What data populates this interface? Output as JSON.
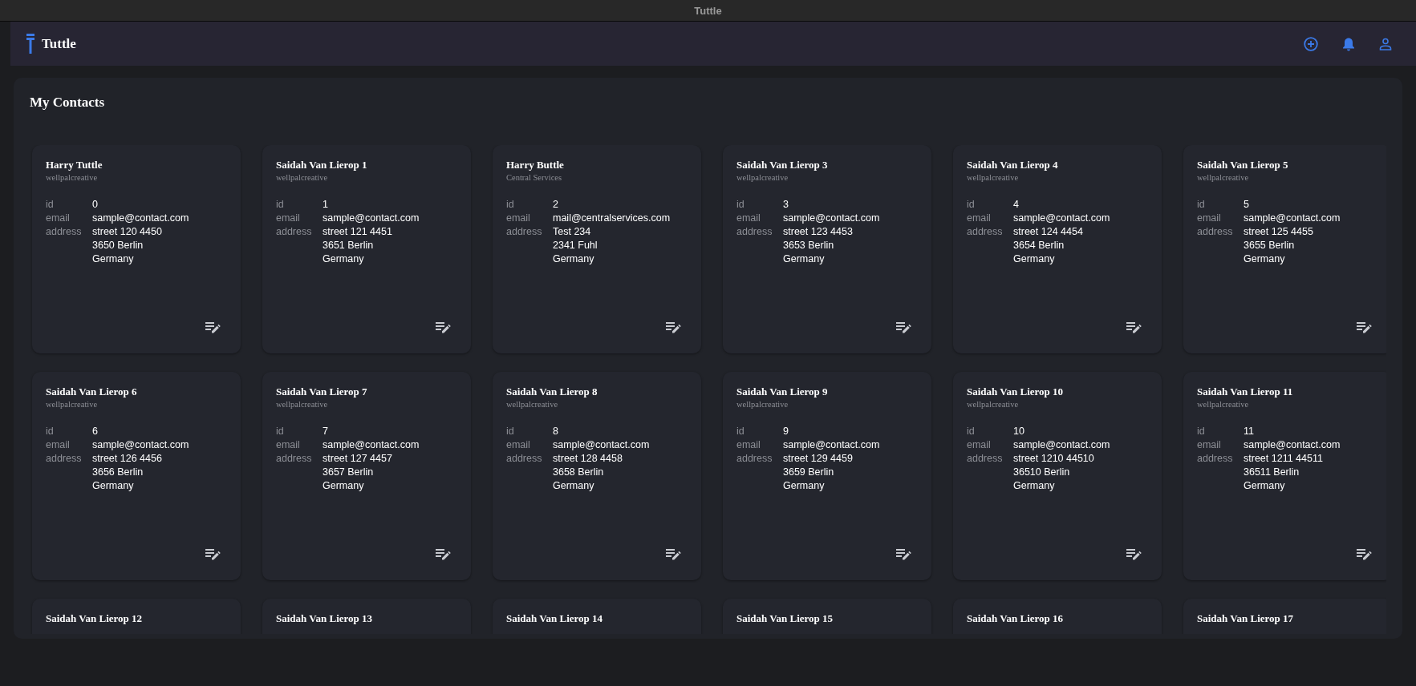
{
  "window": {
    "title": "Tuttle"
  },
  "header": {
    "app_name": "Tuttle"
  },
  "page": {
    "title": "My Contacts"
  },
  "contacts": [
    {
      "name": "Harry Tuttle",
      "company": "wellpalcreative",
      "fields": [
        {
          "label": "id",
          "lines": [
            "0"
          ]
        },
        {
          "label": "email",
          "lines": [
            "sample@contact.com"
          ]
        },
        {
          "label": "address",
          "lines": [
            "street 120 4450",
            "3650 Berlin",
            "Germany"
          ]
        }
      ]
    },
    {
      "name": "Saidah Van Lierop 1",
      "company": "wellpalcreative",
      "fields": [
        {
          "label": "id",
          "lines": [
            "1"
          ]
        },
        {
          "label": "email",
          "lines": [
            "sample@contact.com"
          ]
        },
        {
          "label": "address",
          "lines": [
            "street 121 4451",
            "3651 Berlin",
            "Germany"
          ]
        }
      ]
    },
    {
      "name": "Harry Buttle",
      "company": "Central Services",
      "fields": [
        {
          "label": "id",
          "lines": [
            "2"
          ]
        },
        {
          "label": "email",
          "lines": [
            "mail@centralservices.com"
          ]
        },
        {
          "label": "address",
          "lines": [
            "Test 234",
            "2341 Fuhl",
            "Germany"
          ]
        }
      ]
    },
    {
      "name": "Saidah Van Lierop 3",
      "company": "wellpalcreative",
      "fields": [
        {
          "label": "id",
          "lines": [
            "3"
          ]
        },
        {
          "label": "email",
          "lines": [
            "sample@contact.com"
          ]
        },
        {
          "label": "address",
          "lines": [
            "street 123 4453",
            "3653 Berlin",
            "Germany"
          ]
        }
      ]
    },
    {
      "name": "Saidah Van Lierop 4",
      "company": "wellpalcreative",
      "fields": [
        {
          "label": "id",
          "lines": [
            "4"
          ]
        },
        {
          "label": "email",
          "lines": [
            "sample@contact.com"
          ]
        },
        {
          "label": "address",
          "lines": [
            "street 124 4454",
            "3654 Berlin",
            "Germany"
          ]
        }
      ]
    },
    {
      "name": "Saidah Van Lierop 5",
      "company": "wellpalcreative",
      "fields": [
        {
          "label": "id",
          "lines": [
            "5"
          ]
        },
        {
          "label": "email",
          "lines": [
            "sample@contact.com"
          ]
        },
        {
          "label": "address",
          "lines": [
            "street 125 4455",
            "3655 Berlin",
            "Germany"
          ]
        }
      ]
    },
    {
      "name": "Saidah Van Lierop 6",
      "company": "wellpalcreative",
      "fields": [
        {
          "label": "id",
          "lines": [
            "6"
          ]
        },
        {
          "label": "email",
          "lines": [
            "sample@contact.com"
          ]
        },
        {
          "label": "address",
          "lines": [
            "street 126 4456",
            "3656 Berlin",
            "Germany"
          ]
        }
      ]
    },
    {
      "name": "Saidah Van Lierop 7",
      "company": "wellpalcreative",
      "fields": [
        {
          "label": "id",
          "lines": [
            "7"
          ]
        },
        {
          "label": "email",
          "lines": [
            "sample@contact.com"
          ]
        },
        {
          "label": "address",
          "lines": [
            "street 127 4457",
            "3657 Berlin",
            "Germany"
          ]
        }
      ]
    },
    {
      "name": "Saidah Van Lierop 8",
      "company": "wellpalcreative",
      "fields": [
        {
          "label": "id",
          "lines": [
            "8"
          ]
        },
        {
          "label": "email",
          "lines": [
            "sample@contact.com"
          ]
        },
        {
          "label": "address",
          "lines": [
            "street 128 4458",
            "3658 Berlin",
            "Germany"
          ]
        }
      ]
    },
    {
      "name": "Saidah Van Lierop 9",
      "company": "wellpalcreative",
      "fields": [
        {
          "label": "id",
          "lines": [
            "9"
          ]
        },
        {
          "label": "email",
          "lines": [
            "sample@contact.com"
          ]
        },
        {
          "label": "address",
          "lines": [
            "street 129 4459",
            "3659 Berlin",
            "Germany"
          ]
        }
      ]
    },
    {
      "name": "Saidah Van Lierop 10",
      "company": "wellpalcreative",
      "fields": [
        {
          "label": "id",
          "lines": [
            "10"
          ]
        },
        {
          "label": "email",
          "lines": [
            "sample@contact.com"
          ]
        },
        {
          "label": "address",
          "lines": [
            "street 1210 44510",
            "36510 Berlin",
            "Germany"
          ]
        }
      ]
    },
    {
      "name": "Saidah Van Lierop 11",
      "company": "wellpalcreative",
      "fields": [
        {
          "label": "id",
          "lines": [
            "11"
          ]
        },
        {
          "label": "email",
          "lines": [
            "sample@contact.com"
          ]
        },
        {
          "label": "address",
          "lines": [
            "street 1211 44511",
            "36511 Berlin",
            "Germany"
          ]
        }
      ]
    },
    {
      "name": "Saidah Van Lierop 12"
    },
    {
      "name": "Saidah Van Lierop 13"
    },
    {
      "name": "Saidah Van Lierop 14"
    },
    {
      "name": "Saidah Van Lierop 15"
    },
    {
      "name": "Saidah Van Lierop 16"
    },
    {
      "name": "Saidah Van Lierop 17"
    }
  ]
}
